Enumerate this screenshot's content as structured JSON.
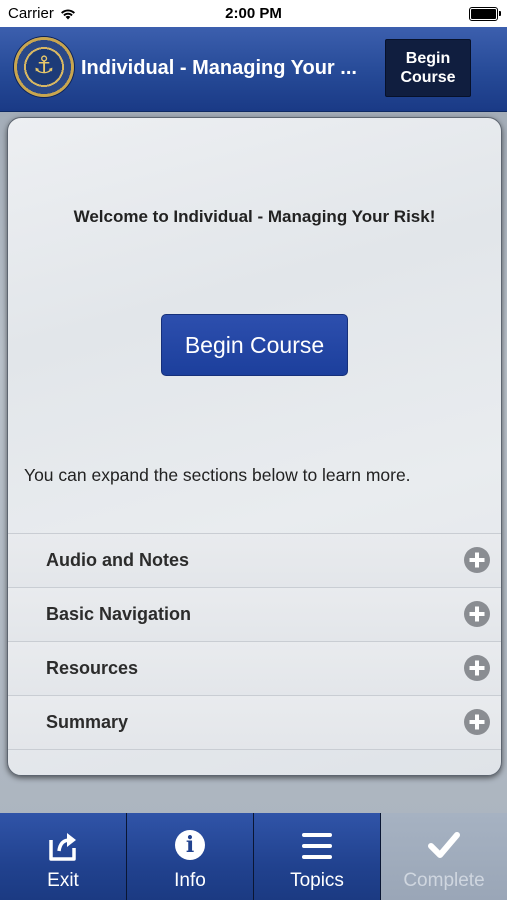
{
  "status_bar": {
    "carrier": "Carrier",
    "time": "2:00 PM"
  },
  "header": {
    "title": "Individual - Managing Your ...",
    "begin_button_label": "Begin Course"
  },
  "content": {
    "welcome": "Welcome to Individual - Managing Your Risk!",
    "begin_button_label": "Begin Course",
    "intro": "You can expand the sections below to learn more.",
    "sections": [
      {
        "label": "Audio and Notes"
      },
      {
        "label": "Basic Navigation"
      },
      {
        "label": "Resources"
      },
      {
        "label": "Summary"
      }
    ]
  },
  "tab_bar": {
    "tabs": [
      {
        "label": "Exit",
        "icon": "exit-icon"
      },
      {
        "label": "Info",
        "icon": "info-icon"
      },
      {
        "label": "Topics",
        "icon": "menu-icon"
      },
      {
        "label": "Complete",
        "icon": "checkmark-icon"
      }
    ],
    "active_index": 3
  },
  "colors": {
    "header_blue": "#264a97",
    "button_blue": "#1c3f9c",
    "dark_button": "#101e3f",
    "inactive_tab": "#9aa6b7"
  }
}
